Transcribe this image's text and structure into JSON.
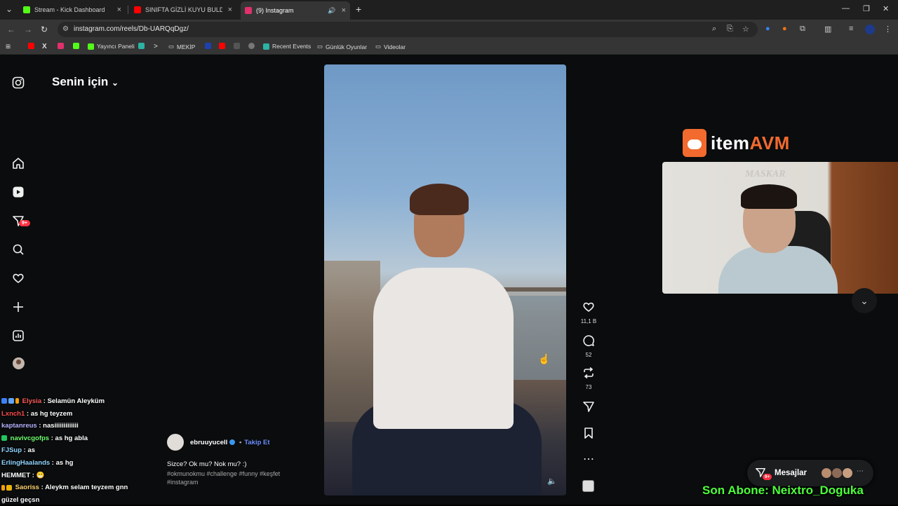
{
  "browser": {
    "tabs": [
      {
        "title": "Stream - Kick Dashboard",
        "fav_color": "#53fc18",
        "active": false
      },
      {
        "title": "SINIFTA GİZLİ KUYU BULDUK! 🧗",
        "fav_color": "#ff0000",
        "active": false
      },
      {
        "title": "(9) Instagram",
        "fav_color": "#e1306c",
        "active": true
      }
    ],
    "url": "instagram.com/reels/Db-UARQqDgz/",
    "bookmarks": [
      {
        "label": "",
        "color": "#ff0000"
      },
      {
        "label": "",
        "color": "#000000"
      },
      {
        "label": "",
        "color": "#e1306c"
      },
      {
        "label": "",
        "color": "#53fc18"
      },
      {
        "label": "Yayıncı Paneli",
        "color": "#53fc18"
      },
      {
        "label": "",
        "color": "#2bb3a3"
      },
      {
        "label": "",
        "color": "#333333"
      },
      {
        "label": "MEKİP",
        "color": "folder"
      },
      {
        "label": "",
        "color": "#1e40af"
      },
      {
        "label": "",
        "color": "#ff0000"
      },
      {
        "label": "",
        "color": "#555555"
      },
      {
        "label": "",
        "color": "#666666"
      },
      {
        "label": "Recent Events",
        "color": "#2bb3a3"
      },
      {
        "label": "Günlük Oyunlar",
        "color": "folder"
      },
      {
        "label": "Videolar",
        "color": "folder"
      }
    ]
  },
  "instagram": {
    "feed_title": "Senin için",
    "notif_badge": "9+",
    "reel": {
      "likes": "11,1 B",
      "comments": "52",
      "reposts": "73",
      "username": "ebruuyucell",
      "follow_label": "Takip Et",
      "separator": "•",
      "caption": "Sizce? Ok mu? Nok mu? :)",
      "tags": "#okmunokmu #challenge #funny #keşfet #instagram"
    },
    "messages": {
      "label": "Mesajlar",
      "badge": "9+"
    }
  },
  "overlay": {
    "logo_prefix": "item",
    "logo_suffix": "AVM",
    "webcam_sign": "MASKAR",
    "last_sub": "Son Abone: Neixtro_Doguka",
    "chat": [
      {
        "user": "Elysia",
        "color": "#ff5a5a",
        "msg": "Selamün Aleyküm"
      },
      {
        "user": "Lxnch1",
        "color": "#ff4a4a",
        "msg": "as hg teyzem"
      },
      {
        "user": "kaptanreus",
        "color": "#b7b2ff",
        "msg": "nasiiiiiiiiiiiii"
      },
      {
        "user": "navivcgofps",
        "color": "#6fff6f",
        "msg": "as hg abla"
      },
      {
        "user": "FJSup",
        "color": "#8fd3ff",
        "msg": "as"
      },
      {
        "user": "ErlingHaalands",
        "color": "#8fd3ff",
        "msg": "as hg"
      },
      {
        "user": "HEMMET",
        "color": "#ffffff",
        "msg": "😁"
      },
      {
        "user": "Saoriss",
        "color": "#ffd36b",
        "msg": "Aleykm selam teyzem gnn"
      },
      {
        "user": "",
        "color": "#ffffff",
        "msg": "güzel geçsn"
      }
    ]
  }
}
